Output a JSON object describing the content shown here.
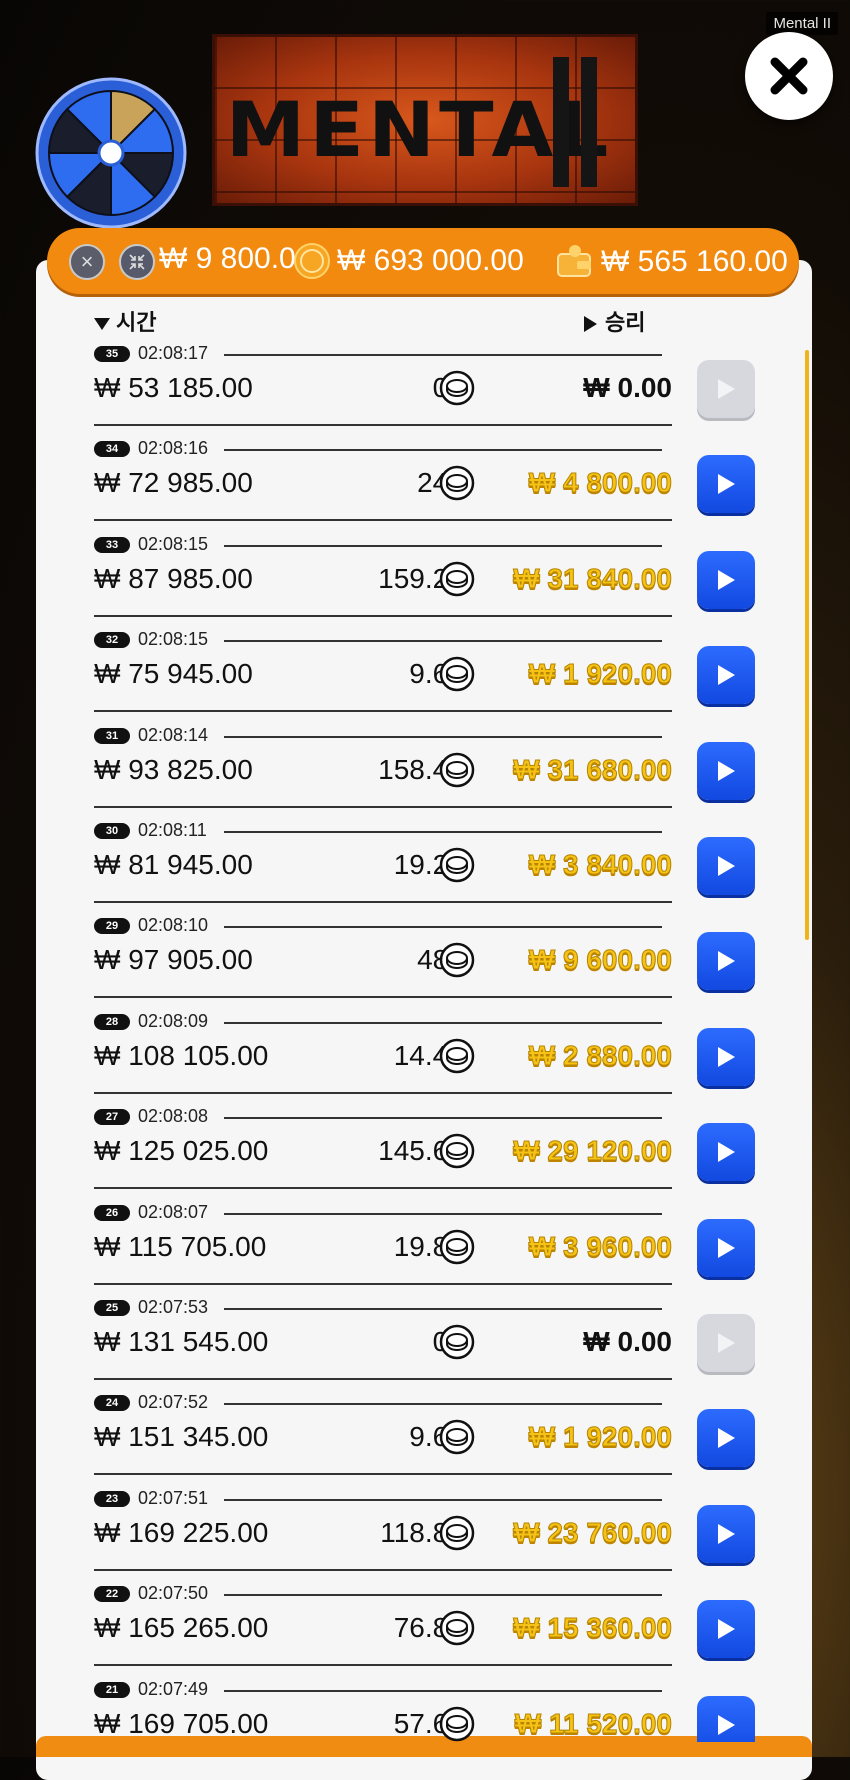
{
  "window": {
    "title": "Mental II"
  },
  "logo": {
    "text": "MENTAL"
  },
  "stats": {
    "bet": "₩ 9 800.00",
    "total_bet": "₩ 693 000.00",
    "balance": "₩ 565 160.00"
  },
  "headers": {
    "time": "시간",
    "win": "승리"
  },
  "colors": {
    "accent_orange": "#f28a0f",
    "play_blue": "#1f5cff",
    "win_gold": "#f5c215"
  },
  "rounds": [
    {
      "num": "35",
      "time": "02:08:17",
      "bet": "₩ 53 185.00",
      "mult": "0 x",
      "win": "₩ 0.00",
      "has_win": false
    },
    {
      "num": "34",
      "time": "02:08:16",
      "bet": "₩ 72 985.00",
      "mult": "24 x",
      "win": "₩ 4 800.00",
      "has_win": true
    },
    {
      "num": "33",
      "time": "02:08:15",
      "bet": "₩ 87 985.00",
      "mult": "159.2 x",
      "win": "₩ 31 840.00",
      "has_win": true
    },
    {
      "num": "32",
      "time": "02:08:15",
      "bet": "₩ 75 945.00",
      "mult": "9.6 x",
      "win": "₩ 1 920.00",
      "has_win": true
    },
    {
      "num": "31",
      "time": "02:08:14",
      "bet": "₩ 93 825.00",
      "mult": "158.4 x",
      "win": "₩ 31 680.00",
      "has_win": true
    },
    {
      "num": "30",
      "time": "02:08:11",
      "bet": "₩ 81 945.00",
      "mult": "19.2 x",
      "win": "₩ 3 840.00",
      "has_win": true
    },
    {
      "num": "29",
      "time": "02:08:10",
      "bet": "₩ 97 905.00",
      "mult": "48 x",
      "win": "₩ 9 600.00",
      "has_win": true
    },
    {
      "num": "28",
      "time": "02:08:09",
      "bet": "₩ 108 105.00",
      "mult": "14.4 x",
      "win": "₩ 2 880.00",
      "has_win": true
    },
    {
      "num": "27",
      "time": "02:08:08",
      "bet": "₩ 125 025.00",
      "mult": "145.6 x",
      "win": "₩ 29 120.00",
      "has_win": true
    },
    {
      "num": "26",
      "time": "02:08:07",
      "bet": "₩ 115 705.00",
      "mult": "19.8 x",
      "win": "₩ 3 960.00",
      "has_win": true
    },
    {
      "num": "25",
      "time": "02:07:53",
      "bet": "₩ 131 545.00",
      "mult": "0 x",
      "win": "₩ 0.00",
      "has_win": false
    },
    {
      "num": "24",
      "time": "02:07:52",
      "bet": "₩ 151 345.00",
      "mult": "9.6 x",
      "win": "₩ 1 920.00",
      "has_win": true
    },
    {
      "num": "23",
      "time": "02:07:51",
      "bet": "₩ 169 225.00",
      "mult": "118.8 x",
      "win": "₩ 23 760.00",
      "has_win": true
    },
    {
      "num": "22",
      "time": "02:07:50",
      "bet": "₩ 165 265.00",
      "mult": "76.8 x",
      "win": "₩ 15 360.00",
      "has_win": true
    },
    {
      "num": "21",
      "time": "02:07:49",
      "bet": "₩ 169 705.00",
      "mult": "57.6 x",
      "win": "₩ 11 520.00",
      "has_win": true
    }
  ]
}
